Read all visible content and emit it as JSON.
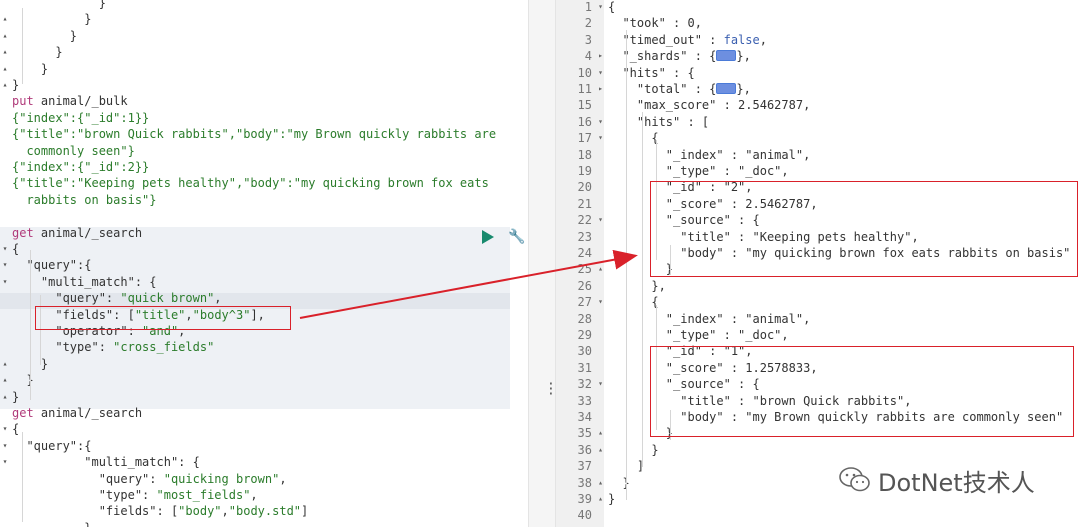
{
  "left_editor": {
    "lines": [
      {
        "i": 0,
        "t": [
          [
            "            }",
            "p"
          ]
        ]
      },
      {
        "i": 0,
        "t": [
          [
            "          }",
            "p"
          ]
        ]
      },
      {
        "i": 0,
        "t": [
          [
            "        }",
            "p"
          ]
        ]
      },
      {
        "i": 0,
        "t": [
          [
            "      }",
            "p"
          ]
        ]
      },
      {
        "i": 0,
        "t": [
          [
            "    }",
            "p"
          ]
        ]
      },
      {
        "i": 0,
        "t": [
          [
            "}",
            "p"
          ]
        ]
      },
      {
        "i": 0,
        "t": [
          [
            "put ",
            "kw"
          ],
          [
            "animal/_bulk",
            "p"
          ]
        ]
      },
      {
        "i": 0,
        "t": [
          [
            "{\"index\":{\"_id\":1}}",
            "str"
          ]
        ]
      },
      {
        "i": 0,
        "t": [
          [
            "{\"title\":\"brown Quick rabbits\",\"body\":\"my Brown quickly rabbits are",
            "str"
          ]
        ]
      },
      {
        "i": 0,
        "t": [
          [
            "  commonly seen\"}",
            "str"
          ]
        ]
      },
      {
        "i": 0,
        "t": [
          [
            "{\"index\":{\"_id\":2}}",
            "str"
          ]
        ]
      },
      {
        "i": 0,
        "t": [
          [
            "{\"title\":\"Keeping pets healthy\",\"body\":\"my quicking brown fox eats",
            "str"
          ]
        ]
      },
      {
        "i": 0,
        "t": [
          [
            "  rabbits on basis\"}",
            "str"
          ]
        ]
      },
      {
        "i": 0,
        "t": [
          [
            "",
            "p"
          ]
        ]
      },
      {
        "i": 0,
        "t": [
          [
            "get ",
            "kw"
          ],
          [
            "animal/_search",
            "p"
          ]
        ]
      },
      {
        "i": 0,
        "t": [
          [
            "{",
            "p"
          ]
        ]
      },
      {
        "i": 0,
        "t": [
          [
            "  \"query\":{",
            "p"
          ]
        ]
      },
      {
        "i": 0,
        "t": [
          [
            "    \"multi_match\": {",
            "p"
          ]
        ]
      },
      {
        "i": 0,
        "t": [
          [
            "      \"query\": ",
            "p"
          ],
          [
            "\"quick brown\"",
            "str"
          ],
          [
            ",",
            "p"
          ]
        ]
      },
      {
        "i": 0,
        "t": [
          [
            "      \"fields\": [",
            "p"
          ],
          [
            "\"title\"",
            "str"
          ],
          [
            ",",
            "p"
          ],
          [
            "\"body^3\"",
            "str"
          ],
          [
            "],",
            "p"
          ]
        ]
      },
      {
        "i": 0,
        "t": [
          [
            "      \"operator\": ",
            "p"
          ],
          [
            "\"and\"",
            "str"
          ],
          [
            ",",
            "p"
          ]
        ]
      },
      {
        "i": 0,
        "t": [
          [
            "      \"type\": ",
            "p"
          ],
          [
            "\"cross_fields\"",
            "str"
          ]
        ]
      },
      {
        "i": 0,
        "t": [
          [
            "    }",
            "p"
          ]
        ]
      },
      {
        "i": 0,
        "t": [
          [
            "  }",
            "p"
          ]
        ]
      },
      {
        "i": 0,
        "t": [
          [
            "}",
            "p"
          ]
        ]
      },
      {
        "i": 0,
        "t": [
          [
            "get ",
            "kw"
          ],
          [
            "animal/_search",
            "p"
          ]
        ]
      },
      {
        "i": 0,
        "t": [
          [
            "{",
            "p"
          ]
        ]
      },
      {
        "i": 0,
        "t": [
          [
            "  \"query\":{",
            "p"
          ]
        ]
      },
      {
        "i": 0,
        "t": [
          [
            "          \"multi_match\": {",
            "p"
          ]
        ]
      },
      {
        "i": 0,
        "t": [
          [
            "            \"query\": ",
            "p"
          ],
          [
            "\"quicking brown\"",
            "str"
          ],
          [
            ",",
            "p"
          ]
        ]
      },
      {
        "i": 0,
        "t": [
          [
            "            \"type\": ",
            "p"
          ],
          [
            "\"most_fields\"",
            "str"
          ],
          [
            ",",
            "p"
          ]
        ]
      },
      {
        "i": 0,
        "t": [
          [
            "            \"fields\": [",
            "p"
          ],
          [
            "\"body\"",
            "str"
          ],
          [
            ",",
            "p"
          ],
          [
            "\"body.std\"",
            "str"
          ],
          [
            "]",
            "p"
          ]
        ]
      },
      {
        "i": 0,
        "t": [
          [
            "          }",
            "p"
          ]
        ]
      }
    ]
  },
  "right_editor": {
    "lines": [
      {
        "n": "1",
        "f": "▾",
        "t": [
          [
            "{",
            "p"
          ]
        ]
      },
      {
        "n": "2",
        "f": "",
        "t": [
          [
            "  \"took\" : ",
            "p"
          ],
          [
            "0",
            "num"
          ],
          [
            ",",
            "p"
          ]
        ]
      },
      {
        "n": "3",
        "f": "",
        "t": [
          [
            "  \"timed_out\" : ",
            "p"
          ],
          [
            "false",
            "kw"
          ],
          [
            ",",
            "p"
          ]
        ]
      },
      {
        "n": "4",
        "f": "▸",
        "t": [
          [
            "  \"_shards\" : {",
            "p"
          ],
          [
            "[c]",
            "c"
          ],
          [
            "},",
            "p"
          ]
        ]
      },
      {
        "n": "10",
        "f": "▾",
        "t": [
          [
            "  \"hits\" : {",
            "p"
          ]
        ]
      },
      {
        "n": "11",
        "f": "▸",
        "t": [
          [
            "    \"total\" : {",
            "p"
          ],
          [
            "[c]",
            "c"
          ],
          [
            "},",
            "p"
          ]
        ]
      },
      {
        "n": "15",
        "f": "",
        "t": [
          [
            "    \"max_score\" : ",
            "p"
          ],
          [
            "2.5462787",
            "num"
          ],
          [
            ",",
            "p"
          ]
        ]
      },
      {
        "n": "16",
        "f": "▾",
        "t": [
          [
            "    \"hits\" : [",
            "p"
          ]
        ]
      },
      {
        "n": "17",
        "f": "▾",
        "t": [
          [
            "      {",
            "p"
          ]
        ]
      },
      {
        "n": "18",
        "f": "",
        "t": [
          [
            "        \"_index\" : ",
            "p"
          ],
          [
            "\"animal\"",
            "p"
          ],
          [
            ",",
            "p"
          ]
        ]
      },
      {
        "n": "19",
        "f": "",
        "t": [
          [
            "        \"_type\" : ",
            "p"
          ],
          [
            "\"_doc\"",
            "p"
          ],
          [
            ",",
            "p"
          ]
        ]
      },
      {
        "n": "20",
        "f": "",
        "t": [
          [
            "        \"_id\" : ",
            "p"
          ],
          [
            "\"2\"",
            "p"
          ],
          [
            ",",
            "p"
          ]
        ]
      },
      {
        "n": "21",
        "f": "",
        "t": [
          [
            "        \"_score\" : ",
            "p"
          ],
          [
            "2.5462787",
            "num"
          ],
          [
            ",",
            "p"
          ]
        ]
      },
      {
        "n": "22",
        "f": "▾",
        "t": [
          [
            "        \"_source\" : {",
            "p"
          ]
        ]
      },
      {
        "n": "23",
        "f": "",
        "t": [
          [
            "          \"title\" : ",
            "p"
          ],
          [
            "\"Keeping pets healthy\"",
            "p"
          ],
          [
            ",",
            "p"
          ]
        ]
      },
      {
        "n": "24",
        "f": "",
        "t": [
          [
            "          \"body\" : ",
            "p"
          ],
          [
            "\"my quicking brown fox eats rabbits on basis\"",
            "p"
          ]
        ]
      },
      {
        "n": "25",
        "f": "▴",
        "t": [
          [
            "        }",
            "p"
          ]
        ]
      },
      {
        "n": "26",
        "f": "",
        "t": [
          [
            "      },",
            "p"
          ]
        ]
      },
      {
        "n": "27",
        "f": "▾",
        "t": [
          [
            "      {",
            "p"
          ]
        ]
      },
      {
        "n": "28",
        "f": "",
        "t": [
          [
            "        \"_index\" : ",
            "p"
          ],
          [
            "\"animal\"",
            "p"
          ],
          [
            ",",
            "p"
          ]
        ]
      },
      {
        "n": "29",
        "f": "",
        "t": [
          [
            "        \"_type\" : ",
            "p"
          ],
          [
            "\"_doc\"",
            "p"
          ],
          [
            ",",
            "p"
          ]
        ]
      },
      {
        "n": "30",
        "f": "",
        "t": [
          [
            "        \"_id\" : ",
            "p"
          ],
          [
            "\"1\"",
            "p"
          ],
          [
            ",",
            "p"
          ]
        ]
      },
      {
        "n": "31",
        "f": "",
        "t": [
          [
            "        \"_score\" : ",
            "p"
          ],
          [
            "1.2578833",
            "num"
          ],
          [
            ",",
            "p"
          ]
        ]
      },
      {
        "n": "32",
        "f": "▾",
        "t": [
          [
            "        \"_source\" : {",
            "p"
          ]
        ]
      },
      {
        "n": "33",
        "f": "",
        "t": [
          [
            "          \"title\" : ",
            "p"
          ],
          [
            "\"brown Quick rabbits\"",
            "p"
          ],
          [
            ",",
            "p"
          ]
        ]
      },
      {
        "n": "34",
        "f": "",
        "t": [
          [
            "          \"body\" : ",
            "p"
          ],
          [
            "\"my Brown quickly rabbits are commonly seen\"",
            "p"
          ]
        ]
      },
      {
        "n": "35",
        "f": "▴",
        "t": [
          [
            "        }",
            "p"
          ]
        ]
      },
      {
        "n": "36",
        "f": "▴",
        "t": [
          [
            "      }",
            "p"
          ]
        ]
      },
      {
        "n": "37",
        "f": "",
        "t": [
          [
            "    ]",
            "p"
          ]
        ]
      },
      {
        "n": "38",
        "f": "▴",
        "t": [
          [
            "  }",
            "p"
          ]
        ]
      },
      {
        "n": "39",
        "f": "▴",
        "t": [
          [
            "}",
            "p"
          ]
        ]
      },
      {
        "n": "40",
        "f": "",
        "t": [
          [
            "",
            "p"
          ]
        ]
      }
    ]
  },
  "watermark": {
    "text": "DotNet技术人",
    "icon": "wechat-icon"
  },
  "colors": {
    "highlight_box": "#d9212a",
    "arrow": "#d9212a",
    "run_button": "#178a6d",
    "wrench": "#2f6ecf"
  }
}
